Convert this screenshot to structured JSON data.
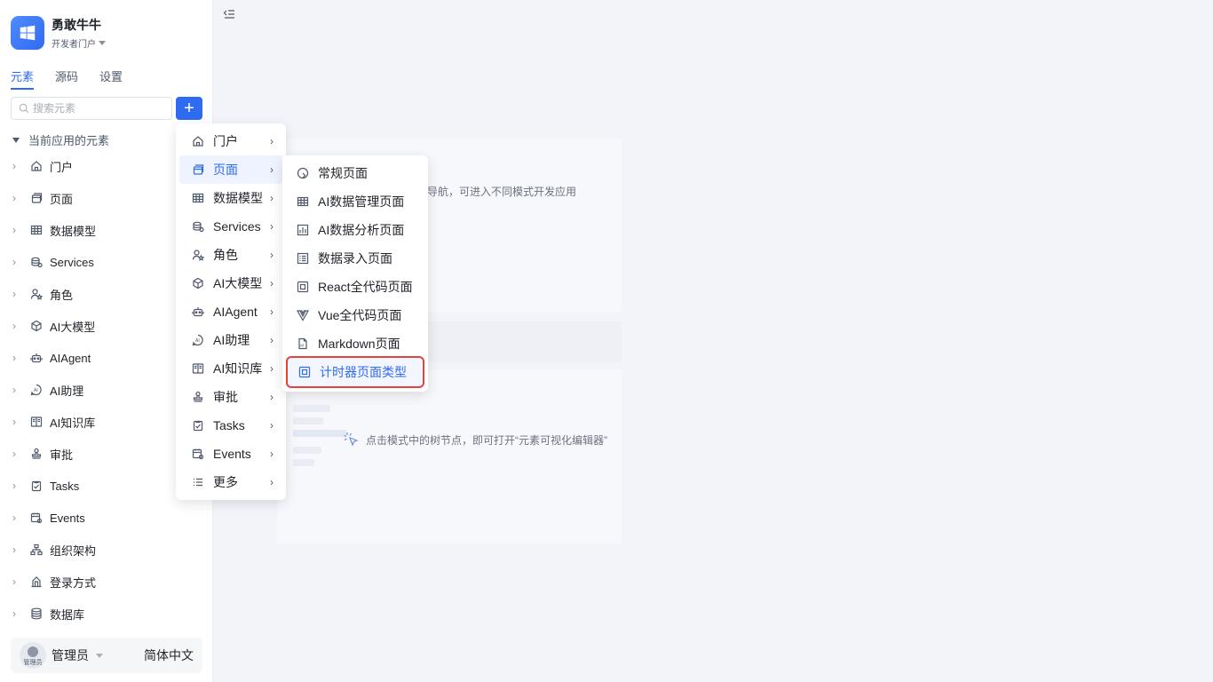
{
  "brand": {
    "name": "勇敢牛牛",
    "subtitle": "开发者门户"
  },
  "tabs": [
    "元素",
    "源码",
    "设置"
  ],
  "search": {
    "placeholder": "搜索元素"
  },
  "add_button": "+",
  "section_title": "当前应用的元素",
  "tree": [
    {
      "label": "门户",
      "icon": "home-icon"
    },
    {
      "label": "页面",
      "icon": "page-icon"
    },
    {
      "label": "数据模型",
      "icon": "table-icon"
    },
    {
      "label": "Services",
      "icon": "database-icon"
    },
    {
      "label": "角色",
      "icon": "role-icon"
    },
    {
      "label": "AI大模型",
      "icon": "model-icon"
    },
    {
      "label": "AIAgent",
      "icon": "robot-icon"
    },
    {
      "label": "AI助理",
      "icon": "ai-assistant-icon"
    },
    {
      "label": "AI知识库",
      "icon": "knowledge-icon"
    },
    {
      "label": "审批",
      "icon": "stamp-icon"
    },
    {
      "label": "Tasks",
      "icon": "task-icon"
    },
    {
      "label": "Events",
      "icon": "event-icon"
    },
    {
      "label": "组织架构",
      "icon": "org-icon"
    },
    {
      "label": "登录方式",
      "icon": "login-icon"
    },
    {
      "label": "数据库",
      "icon": "db-icon"
    }
  ],
  "user": {
    "name": "管理员",
    "avatar_text": "管理员",
    "language": "简体中文"
  },
  "menu_level1": [
    {
      "label": "门户",
      "icon": "home-icon"
    },
    {
      "label": "页面",
      "icon": "page-icon",
      "active": true
    },
    {
      "label": "数据模型",
      "icon": "table-icon"
    },
    {
      "label": "Services",
      "icon": "database-icon"
    },
    {
      "label": "角色",
      "icon": "role-icon"
    },
    {
      "label": "AI大模型",
      "icon": "model-icon"
    },
    {
      "label": "AIAgent",
      "icon": "robot-icon"
    },
    {
      "label": "AI助理",
      "icon": "ai-assistant-icon"
    },
    {
      "label": "AI知识库",
      "icon": "knowledge-icon"
    },
    {
      "label": "审批",
      "icon": "stamp-icon"
    },
    {
      "label": "Tasks",
      "icon": "task-icon"
    },
    {
      "label": "Events",
      "icon": "event-icon"
    },
    {
      "label": "更多",
      "icon": "more-icon"
    }
  ],
  "menu_level2": [
    {
      "label": "常规页面",
      "icon": "regular-page-icon"
    },
    {
      "label": "AI数据管理页面",
      "icon": "table-icon"
    },
    {
      "label": "AI数据分析页面",
      "icon": "bar-chart-icon"
    },
    {
      "label": "数据录入页面",
      "icon": "form-icon"
    },
    {
      "label": "React全代码页面",
      "icon": "code-icon"
    },
    {
      "label": "Vue全代码页面",
      "icon": "vue-icon"
    },
    {
      "label": "Markdown页面",
      "icon": "markdown-icon"
    },
    {
      "label": "计时器页面类型",
      "icon": "timer-icon",
      "highlighted": true
    }
  ],
  "hints": {
    "top": "导航，可进入不同模式开发应用",
    "bottom": "点击模式中的树节点，即可打开“元素可视化编辑器”"
  },
  "colors": {
    "accent": "#2f6bf0",
    "highlight_border": "#e0453a"
  }
}
